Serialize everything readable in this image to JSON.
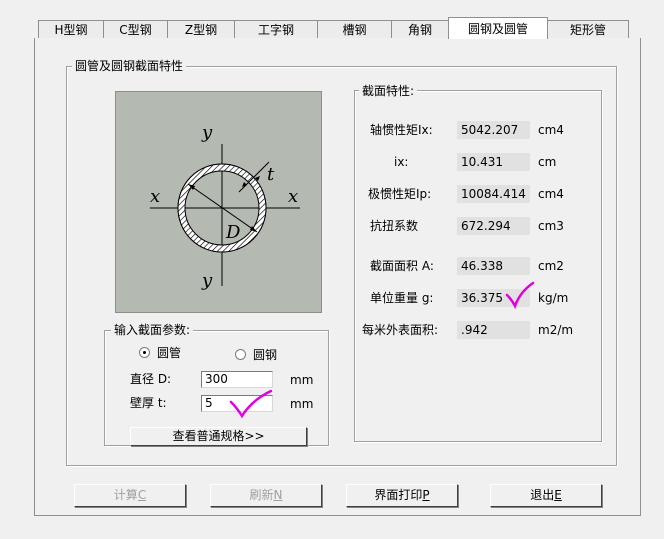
{
  "tabs": [
    {
      "label": "H型钢",
      "active": false
    },
    {
      "label": "C型钢",
      "active": false
    },
    {
      "label": "Z型钢",
      "active": false
    },
    {
      "label": "工字钢",
      "active": false
    },
    {
      "label": "槽钢",
      "active": false
    },
    {
      "label": "角钢",
      "active": false
    },
    {
      "label": "圆钢及圆管",
      "active": true
    },
    {
      "label": "矩形管",
      "active": false
    }
  ],
  "outer_group_title": "圆管及圆钢截面特性",
  "diagram": {
    "axis_y_top": "y",
    "axis_y_bottom": "y",
    "axis_x_left": "x",
    "axis_x_right": "x",
    "dim_t": "t",
    "dim_D": "D",
    "background_color": "#b4b9b1"
  },
  "props_group_title": "截面特性:",
  "properties": [
    {
      "label": "轴惯性矩Ix:",
      "value": "5042.207",
      "unit": "cm4"
    },
    {
      "label": "ix:",
      "value": "10.431",
      "unit": "cm"
    },
    {
      "label": "极惯性矩Ip:",
      "value": "10084.414",
      "unit": "cm4"
    },
    {
      "label": "抗扭系数",
      "value": "672.294",
      "unit": "cm3"
    },
    {
      "label": "截面面积 A:",
      "value": "46.338",
      "unit": "cm2"
    },
    {
      "label": "单位重量 g:",
      "value": "36.375",
      "unit": "kg/m"
    },
    {
      "label": "每米外表面积:",
      "value": ".942",
      "unit": "m2/m"
    }
  ],
  "input_group_title": "输入截面参数:",
  "radio_pipe": "圆管",
  "radio_bar": "圆钢",
  "diameter": {
    "label": "直径 D:",
    "value": "300",
    "unit": "mm"
  },
  "thickness": {
    "label": "壁厚 t:",
    "value": "5",
    "unit": "mm"
  },
  "view_spec_button": "查看普通规格>>",
  "buttons": {
    "calc": {
      "text": "计算",
      "key": "C"
    },
    "refresh": {
      "text": "刷新",
      "key": "N"
    },
    "print": {
      "text": "界面打印",
      "key": "P"
    },
    "exit": {
      "text": "退出",
      "key": "E"
    }
  },
  "colors": {
    "checkmark": "#e000e0",
    "window_bg": "#f0f0f0",
    "value_bg": "#e1e1e1"
  }
}
